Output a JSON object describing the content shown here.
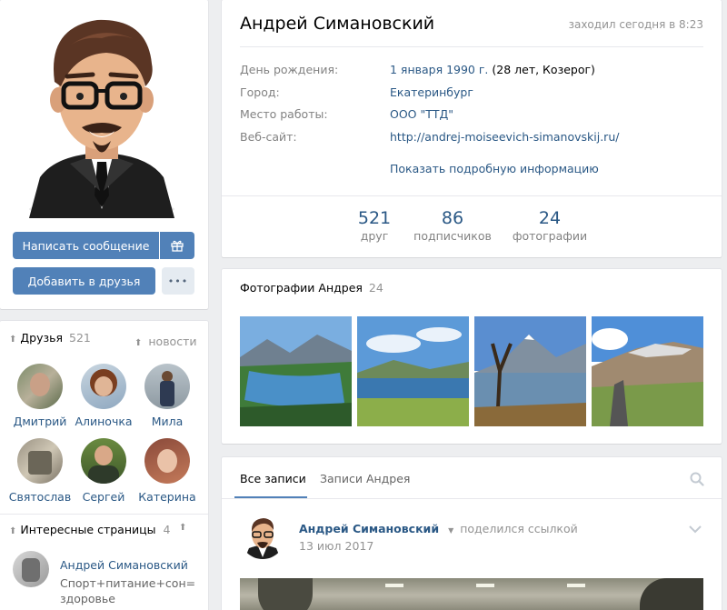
{
  "left": {
    "message_button": "Написать сообщение",
    "gift_icon": "gift-icon",
    "add_friend_button": "Добавить в друзья",
    "more_button": "•••",
    "friends": {
      "title": "Друзья",
      "count": "521",
      "news_label": "новости",
      "items": [
        {
          "name": "Дмитрий"
        },
        {
          "name": "Алиночка"
        },
        {
          "name": "Мила"
        },
        {
          "name": "Святослав"
        },
        {
          "name": "Сергей"
        },
        {
          "name": "Катерина"
        }
      ]
    },
    "pages": {
      "title": "Интересные страницы",
      "count": "4",
      "item_name": "Андрей Симановский",
      "item_desc": "Спорт+питание+сон=здоровье"
    }
  },
  "profile": {
    "name": "Андрей Симановский",
    "last_seen": "заходил сегодня в 8:23",
    "info": [
      {
        "key": "День рождения:",
        "value_link": "1 января 1990 г.",
        "value_rest": " (28 лет, Козерог)"
      },
      {
        "key": "Город:",
        "value_link": "Екатеринбург",
        "value_rest": ""
      },
      {
        "key": "Место работы:",
        "value_link": "ООО \"ТТД\"",
        "value_rest": ""
      },
      {
        "key": "Веб-сайт:",
        "value_link": "http://andrej-moiseevich-simanovskij.ru/",
        "value_rest": ""
      }
    ],
    "show_more": "Показать подробную информацию",
    "counters": [
      {
        "num": "521",
        "label": "друг"
      },
      {
        "num": "86",
        "label": "подписчиков"
      },
      {
        "num": "24",
        "label": "фотографии"
      }
    ]
  },
  "photos": {
    "title": "Фотографии Андрея",
    "count": "24"
  },
  "wall": {
    "tab_all": "Все записи",
    "tab_own": "Записи Андрея",
    "post_author": "Андрей Симановский",
    "post_action": "поделился ссылкой",
    "post_date": "13 июл 2017"
  },
  "colors": {
    "accent": "#5181b8",
    "link": "#2a5885",
    "background": "#edeef0"
  }
}
